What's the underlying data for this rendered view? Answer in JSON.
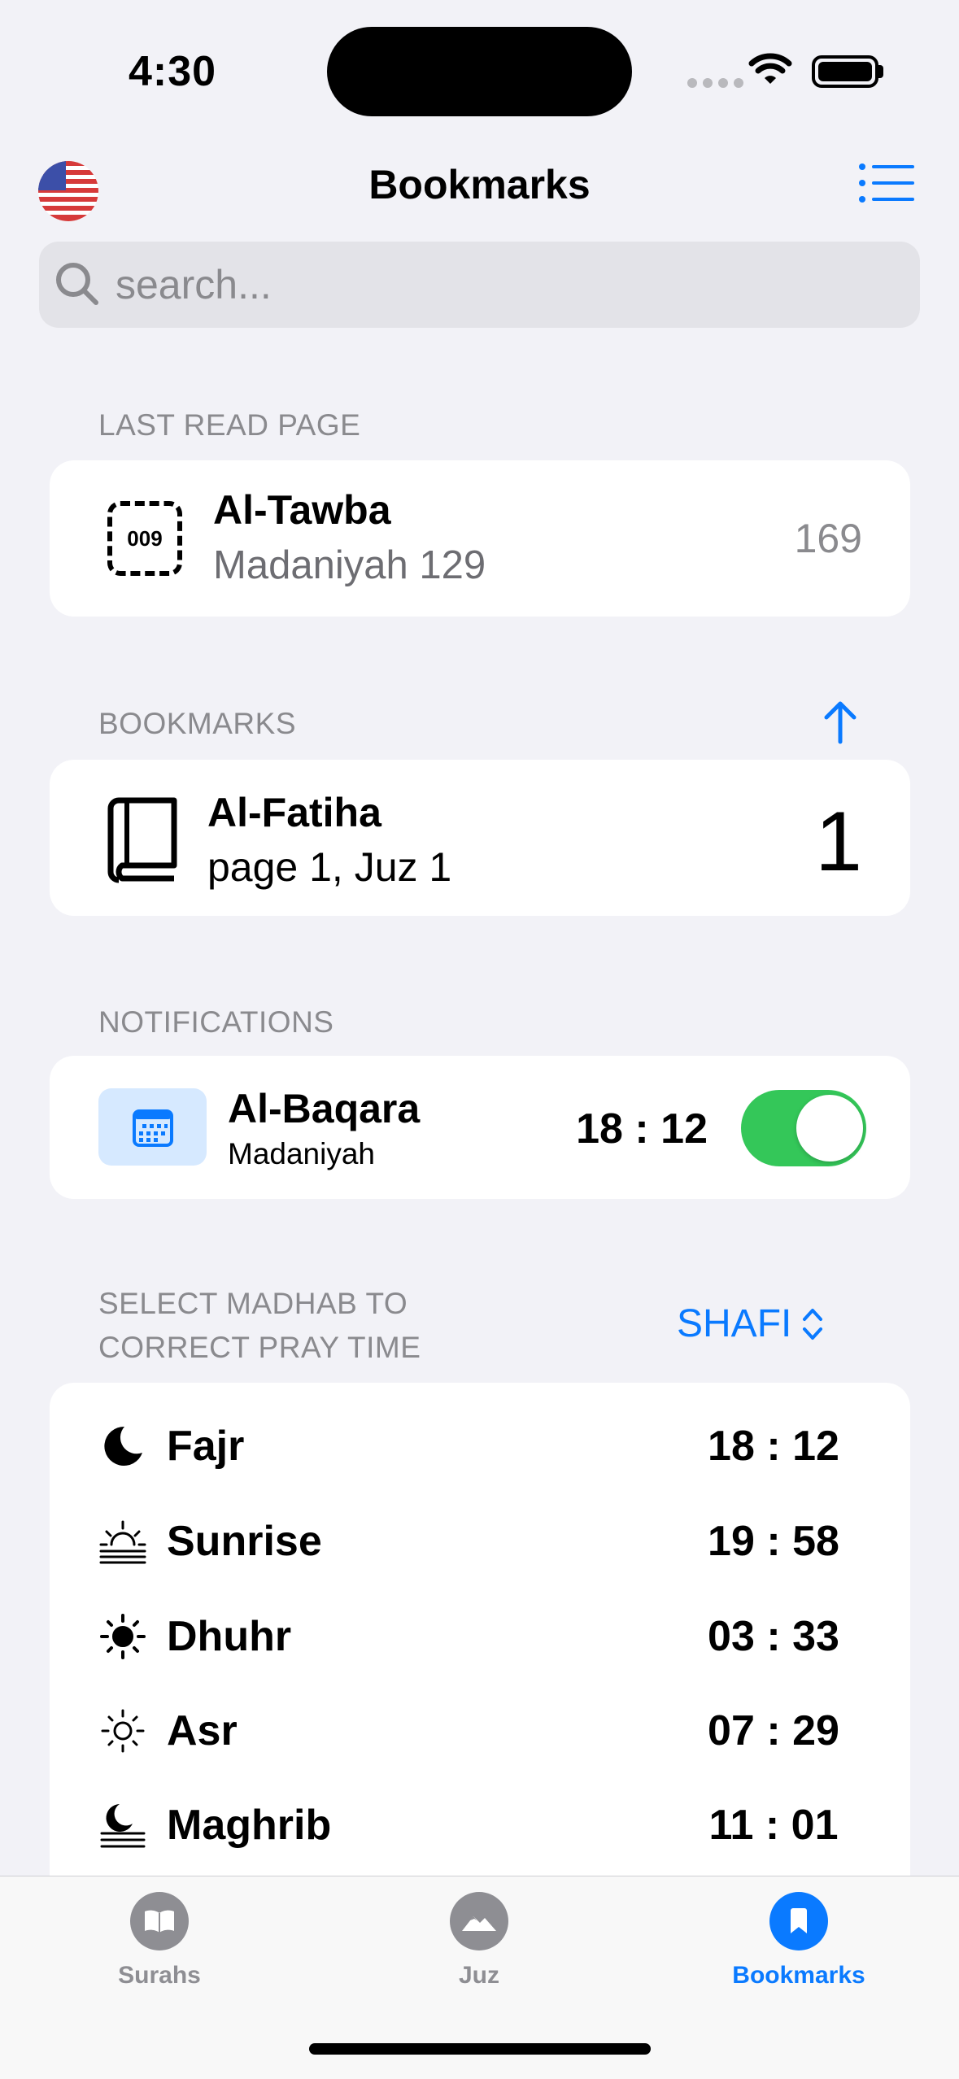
{
  "status_bar": {
    "time": "4:30"
  },
  "nav": {
    "title": "Bookmarks",
    "flag_icon": "us-flag-icon",
    "menu_icon": "list-icon"
  },
  "search": {
    "placeholder": "search..."
  },
  "last_read": {
    "section_label": "LAST READ PAGE",
    "badge": "009",
    "surah": "Al-Tawba",
    "subtitle": "Madaniyah  129",
    "page": "169"
  },
  "bookmarks": {
    "section_label": "BOOKMARKS",
    "items": [
      {
        "surah": "Al-Fatiha",
        "subtitle": "page 1, Juz 1",
        "number": "1"
      }
    ]
  },
  "notifications": {
    "section_label": "NOTIFICATIONS",
    "items": [
      {
        "surah": "Al-Baqara",
        "subtitle": "Madaniyah",
        "time": "18 : 12",
        "enabled": true
      }
    ]
  },
  "madhab": {
    "label_line1": "SELECT MADHAB TO",
    "label_line2": "CORRECT PRAY TIME",
    "selected": "SHAFI"
  },
  "prayers": [
    {
      "name": "Fajr",
      "time": "18 : 12",
      "icon": "moon-icon"
    },
    {
      "name": "Sunrise",
      "time": "19 : 58",
      "icon": "sunrise-icon"
    },
    {
      "name": "Dhuhr",
      "time": "03 : 33",
      "icon": "sun-filled-icon"
    },
    {
      "name": "Asr",
      "time": "07 : 29",
      "icon": "sun-outline-icon"
    },
    {
      "name": "Maghrib",
      "time": "11 : 01",
      "icon": "moon-haze-icon"
    }
  ],
  "tabs": [
    {
      "label": "Surahs",
      "icon": "book-open-icon",
      "active": false
    },
    {
      "label": "Juz",
      "icon": "mountain-icon",
      "active": false
    },
    {
      "label": "Bookmarks",
      "icon": "bookmark-icon",
      "active": true
    }
  ],
  "colors": {
    "accent": "#0A7AFF",
    "toggle_on": "#34C759",
    "background": "#F2F2F7"
  }
}
